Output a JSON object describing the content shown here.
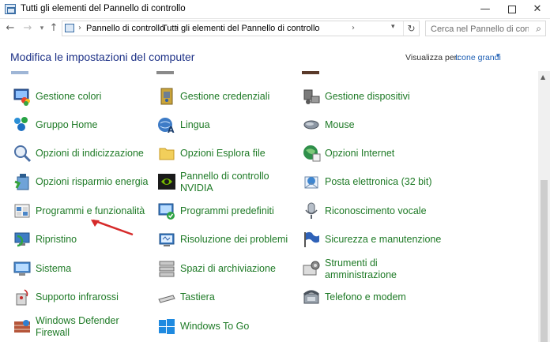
{
  "window": {
    "title": "Tutti gli elementi del Pannello di controllo",
    "minimize_glyph": "—",
    "close_glyph": "✕"
  },
  "nav": {
    "back_glyph": "←",
    "forward_glyph": "→",
    "history_glyph": "▾",
    "up_glyph": "↑"
  },
  "address": {
    "crumbs": [
      "Pannello di controllo",
      "Tutti gli elementi del Pannello di controllo"
    ],
    "separator": "›",
    "dropdown_glyph": "▾",
    "refresh_glyph": "↻"
  },
  "search": {
    "placeholder": "Cerca nel Pannello di controllo",
    "glyph": "⌕"
  },
  "header": {
    "title": "Modifica le impostazioni del computer",
    "view_by_label": "Visualizza per:",
    "view_by_value": "Icone grandi",
    "caret": "▾"
  },
  "scrollbar": {
    "up_glyph": "▲"
  },
  "colors": {
    "link_green": "#1e7a26",
    "title_blue": "#1e3287",
    "accent_blue": "#1e5fb4",
    "annotation_red": "#d62a2a"
  },
  "columns": [
    [
      {
        "label": "Gestione colori",
        "icon": "color-management-icon"
      },
      {
        "label": "Gruppo Home",
        "icon": "homegroup-icon"
      },
      {
        "label": "Opzioni di indicizzazione",
        "icon": "indexing-options-icon"
      },
      {
        "label": "Opzioni risparmio energia",
        "icon": "power-options-icon"
      },
      {
        "label": "Programmi e funzionalità",
        "icon": "programs-features-icon"
      },
      {
        "label": "Ripristino",
        "icon": "recovery-icon"
      },
      {
        "label": "Sistema",
        "icon": "system-icon"
      },
      {
        "label": "Supporto infrarossi",
        "icon": "infrared-icon"
      },
      {
        "label": "Windows Defender Firewall",
        "icon": "firewall-icon"
      }
    ],
    [
      {
        "label": "Gestione credenziali",
        "icon": "credential-manager-icon"
      },
      {
        "label": "Lingua",
        "icon": "language-icon"
      },
      {
        "label": "Opzioni Esplora file",
        "icon": "file-explorer-options-icon"
      },
      {
        "label": "Pannello di controllo NVIDIA",
        "icon": "nvidia-icon"
      },
      {
        "label": "Programmi predefiniti",
        "icon": "default-programs-icon"
      },
      {
        "label": "Risoluzione dei problemi",
        "icon": "troubleshooting-icon"
      },
      {
        "label": "Spazi di archiviazione",
        "icon": "storage-spaces-icon"
      },
      {
        "label": "Tastiera",
        "icon": "keyboard-icon"
      },
      {
        "label": "Windows To Go",
        "icon": "windows-to-go-icon"
      }
    ],
    [
      {
        "label": "Gestione dispositivi",
        "icon": "device-manager-icon"
      },
      {
        "label": "Mouse",
        "icon": "mouse-icon"
      },
      {
        "label": "Opzioni Internet",
        "icon": "internet-options-icon"
      },
      {
        "label": "Posta elettronica (32 bit)",
        "icon": "mail-icon"
      },
      {
        "label": "Riconoscimento vocale",
        "icon": "speech-recognition-icon"
      },
      {
        "label": "Sicurezza e manutenzione",
        "icon": "security-maintenance-icon"
      },
      {
        "label": "Strumenti di amministrazione",
        "icon": "admin-tools-icon"
      },
      {
        "label": "Telefono e modem",
        "icon": "phone-modem-icon"
      }
    ]
  ]
}
